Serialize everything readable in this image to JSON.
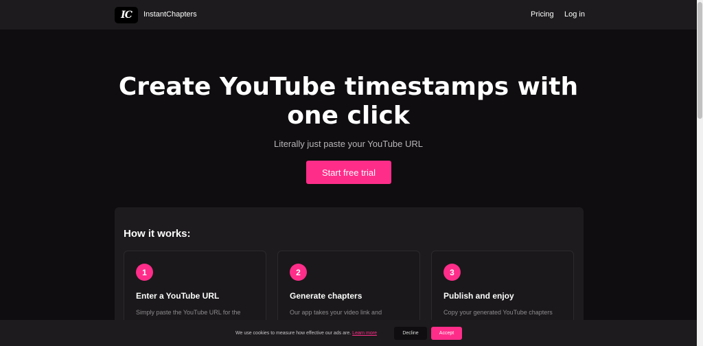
{
  "nav": {
    "logo_text": "IC",
    "brand": "InstantChapters",
    "links": [
      {
        "label": "Pricing"
      },
      {
        "label": "Log in"
      }
    ]
  },
  "hero": {
    "title_line1": "Create YouTube timestamps with",
    "title_line2": "one click",
    "subtitle": "Literally just paste your YouTube URL",
    "cta_label": "Start free trial"
  },
  "how_it_works": {
    "title": "How it works:",
    "steps": [
      {
        "number": "1",
        "title": "Enter a YouTube URL",
        "desc": "Simply paste the YouTube URL for the"
      },
      {
        "number": "2",
        "title": "Generate chapters",
        "desc": "Our app takes your video link and"
      },
      {
        "number": "3",
        "title": "Publish and enjoy",
        "desc": "Copy your generated YouTube chapters"
      }
    ]
  },
  "cookie": {
    "text": "We use cookies to measure how effective our ads are.",
    "link": "Learn more",
    "decline": "Decline",
    "accept": "Accept"
  },
  "colors": {
    "accent": "#ff2d8a",
    "background": "#0f0d0f",
    "panel": "#1d1b1d"
  }
}
